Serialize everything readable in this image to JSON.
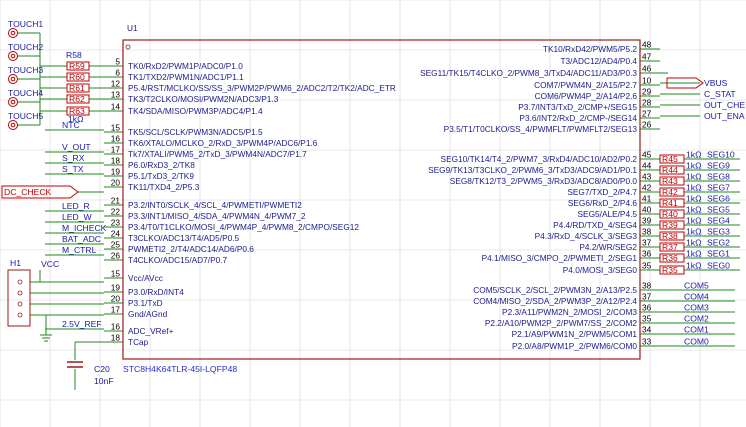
{
  "chip": {
    "designator": "U1",
    "part_number": "STC8H4K64TLR-45I-LQFP48",
    "left_pins": [
      {
        "num": "5",
        "label": "TK0/RxD2/PWM1P/ADC0/P1.0"
      },
      {
        "num": "6",
        "label": "TK1/TXD2/PWM1N/ADC1/P1.1"
      },
      {
        "num": "12",
        "label": "P5.4/RST/MCLKO/SS/SS_3/PWM2P/PWM6_2/ADC2/T2/TK2/ADC_ETR"
      },
      {
        "num": "13",
        "label": "TK3/T2CLKO/MOSI/PWM2N/ADC3/P1.3"
      },
      {
        "num": "14",
        "label": "TK4/SDA/MISO/PWM3P/ADC4/P1.4"
      },
      {
        "num": "15",
        "label": "TK5/SCL/SCLK/PWM3N/ADC5/P1.5"
      },
      {
        "num": "16",
        "label": "TK6/XTALO/MCLKO_2/RxD_3/PWM4P/ADC6/P1.6"
      },
      {
        "num": "17",
        "label": "Tk7/XTALI/PWM5_2/TxD_3/PWM4N/ADC7/P1.7"
      },
      {
        "num": "18",
        "label": "P6.0/RxD3_2/TK8"
      },
      {
        "num": "19",
        "label": "P5.1/TxD3_2/TK9"
      },
      {
        "num": "20",
        "label": "TK11/TXD4_2/P5.3"
      },
      {
        "num": "21",
        "label": "P3.2/INT0/SCLK_4/SCL_4/PWMETI/PWMETI2"
      },
      {
        "num": "22",
        "label": "P3.3/INT1/MISO_4/SDA_4/PWM4N_4/PWM7_2"
      },
      {
        "num": "23",
        "label": "P3.4/T0/T1CLKO/MOSI_4/PWM4P_4/PWM8_2/CMPO/SEG12"
      },
      {
        "num": "24",
        "label": "T3CLKO/ADC13/T4/AD5/P0.5"
      },
      {
        "num": "25",
        "label": "PWMETI2_2/T4/ADC14/AD6/P0.6"
      },
      {
        "num": "26",
        "label": "T4CLKO/ADC15/AD7/P0.7"
      },
      {
        "num": "15",
        "label": "Vcc/AVcc"
      },
      {
        "num": "19",
        "label": "P3.0/RxD/INT4"
      },
      {
        "num": "20",
        "label": "P3.1/TxD"
      },
      {
        "num": "17",
        "label": "Gnd/AGnd"
      },
      {
        "num": "16",
        "label": "ADC_VRef+"
      },
      {
        "num": "18",
        "label": "TCap"
      }
    ],
    "right_pins": [
      {
        "num": "48",
        "label": "TK10/RxD42/PWM5/P5.2"
      },
      {
        "num": "47",
        "label": "T3/ADC12/AD4/P0.4"
      },
      {
        "num": "46",
        "label": "SEG11/TK15/T4CLKO_2/PWM8_3/TxD4/ADC11/AD3/P0.3"
      },
      {
        "num": "10",
        "label": "COM7/PWM4N_2/A15/P2.7"
      },
      {
        "num": "29",
        "label": "COM6/PWM4P_2/A14/P2.6"
      },
      {
        "num": "28",
        "label": "P3.7/INT3/TxD_2/CMP+/SEG15"
      },
      {
        "num": "27",
        "label": "P3.6/INT2/RxD_2/CMP-/SEG14"
      },
      {
        "num": "26",
        "label": "P3.5/T1/T0CLKO/SS_4/PWMFLT/PWMFLT2/SEG13"
      },
      {
        "num": "45",
        "label": "SEG10/TK14/T4_2/PWM7_3/RxD4/ADC10/AD2/P0.2"
      },
      {
        "num": "44",
        "label": "SEG9/TK13/T3CLKO_2/PWM6_3/TxD3/ADC9/AD1/P0.1"
      },
      {
        "num": "43",
        "label": "SEG8/TK12/T3_2/PWM5_3/RxD3/ADC8/AD0/P0.0"
      },
      {
        "num": "42",
        "label": "SEG7/TXD_2/P4.7"
      },
      {
        "num": "41",
        "label": "SEG6/RxD_2/P4.6"
      },
      {
        "num": "40",
        "label": "SEG5/ALE/P4.5"
      },
      {
        "num": "39",
        "label": "P4.4/RD/TXD_4/SEG4"
      },
      {
        "num": "38",
        "label": "P4.3/RxD_4/SCLK_3/SEG3"
      },
      {
        "num": "37",
        "label": "P4.2/WR/SEG2"
      },
      {
        "num": "36",
        "label": "P4.1/MISO_3/CMPO_2/PWMETI_2/SEG1"
      },
      {
        "num": "35",
        "label": "P4.0/MOSI_3/SEG0"
      },
      {
        "num": "38",
        "label": "COM5/SCLK_2/SCL_2/PWM3N_2/A13/P2.5"
      },
      {
        "num": "37",
        "label": "COM4/MISO_2/SDA_2/PWM3P_2/A12/P2.4"
      },
      {
        "num": "36",
        "label": "P2.3/A11/PWM2N_2/MOSI_2/COM3"
      },
      {
        "num": "35",
        "label": "P2.2/A10/PWM2P_2/PWM7/SS_2/COM2"
      },
      {
        "num": "34",
        "label": "P2.1/A9/PWM1N_2/PWM5/COM1"
      },
      {
        "num": "33",
        "label": "P2.0/A8/PWM1P_2/PWM6/COM0"
      }
    ]
  },
  "touch_ports": [
    "TOUCH1",
    "TOUCH2",
    "TOUCH3",
    "TOUCH4",
    "TOUCH5"
  ],
  "left_resistors": {
    "ref": "R58",
    "values": [
      "R59",
      "R60",
      "R61",
      "R62",
      "R63"
    ],
    "value_label": "1kΩ"
  },
  "left_nets": [
    "NTC",
    "V_OUT",
    "S_RX",
    "S_TX",
    "LED_R",
    "LED_W",
    "M_ICHECK",
    "BAT_ADC",
    "M_CTRL",
    "2.5V_REF"
  ],
  "dc_check": "DC_CHECK",
  "connector": {
    "ref": "H1",
    "vcc": "VCC"
  },
  "capacitor": {
    "ref": "C20",
    "value": "10nF"
  },
  "right_ports": [
    "VBUS",
    "C_STAT",
    "OUT_CHE",
    "OUT_ENA"
  ],
  "seg_resistors": {
    "refs": [
      "R45",
      "R44",
      "R43",
      "R42",
      "R41",
      "R40",
      "R39",
      "R38",
      "R37",
      "R36",
      "R35"
    ],
    "value": "1kΩ",
    "nets": [
      "SEG10",
      "SEG9",
      "SEG8",
      "SEG7",
      "SEG6",
      "SEG5",
      "SEG4",
      "SEG3",
      "SEG2",
      "SEG1",
      "SEG0"
    ]
  },
  "com_nets": [
    "COM5",
    "COM4",
    "COM3",
    "COM2",
    "COM1",
    "COM0"
  ],
  "colors": {
    "wire": "#1f8a1f",
    "body": "#9b1a1a",
    "text": "#1b1b8c",
    "port": "#c00000",
    "grid": "#d6d6d6"
  }
}
